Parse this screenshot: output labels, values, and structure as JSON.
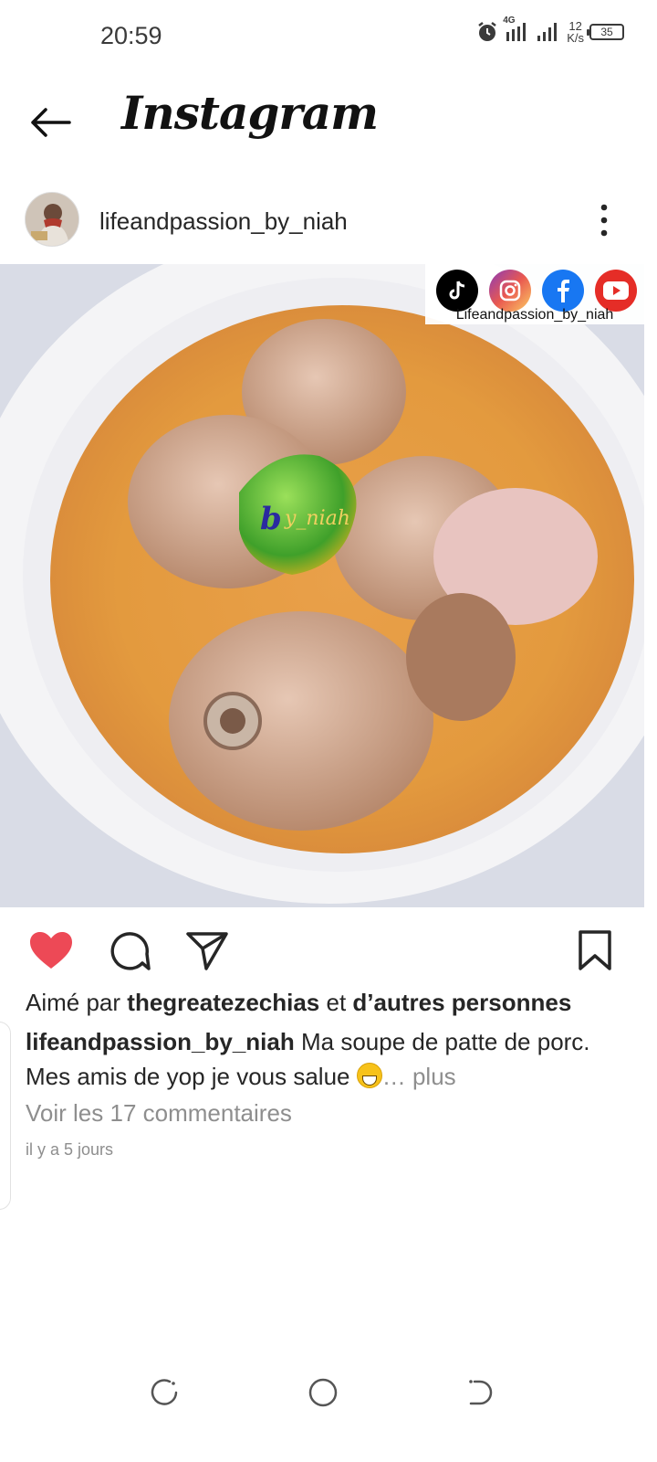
{
  "status_bar": {
    "time": "20:59",
    "network": "4G",
    "net_speed_value": "12",
    "net_speed_unit": "K/s",
    "battery": "35"
  },
  "header": {
    "app_title": "Instagram"
  },
  "post": {
    "username": "lifeandpassion_by_niah",
    "image_watermark": {
      "handle": "Lifeandpassion_by_niah",
      "stamp": "by_niah",
      "icons": [
        "tiktok-icon",
        "instagram-icon",
        "facebook-icon",
        "youtube-icon"
      ]
    },
    "liked": true,
    "likes": {
      "prefix": "Aimé par",
      "user": "thegreatezechias",
      "connector": "et",
      "others": "d’autres personnes"
    },
    "caption": {
      "author": "lifeandpassion_by_niah",
      "text": "Ma soupe de patte de porc. Mes amis de yop je vous salue",
      "more_label": "… plus"
    },
    "comments_link": "Voir les 17 commentaires",
    "time_ago": "il y a 5 jours"
  },
  "colors": {
    "like_red": "#ed4956",
    "secondary_text": "#8e8e8e",
    "primary_text": "#262626"
  }
}
